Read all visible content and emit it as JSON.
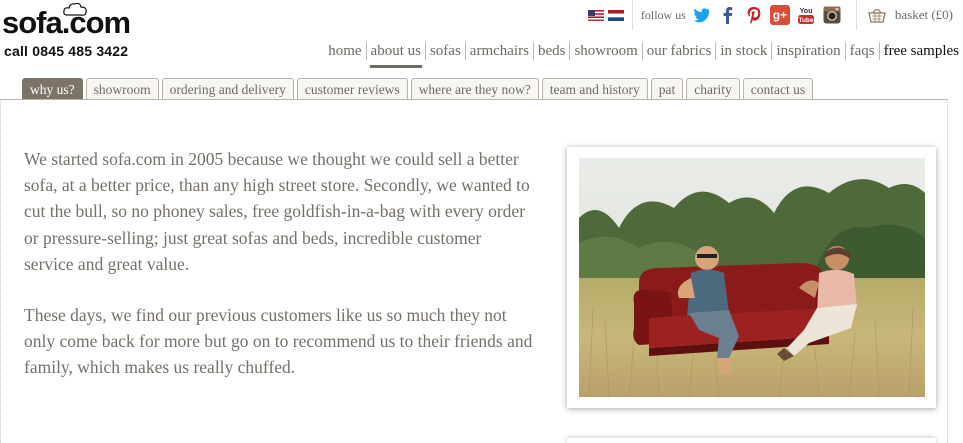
{
  "logo": {
    "text": "sofa.com",
    "phone": "call 0845 485 3422"
  },
  "utility": {
    "flags": [
      "us-flag-icon",
      "netherlands-flag-icon"
    ],
    "follow_label": "follow us",
    "social": [
      "twitter-icon",
      "facebook-icon",
      "pinterest-icon",
      "google-plus-icon",
      "youtube-icon",
      "instagram-icon"
    ],
    "basket_label": "basket (£0)"
  },
  "mainnav": {
    "items": [
      "home",
      "about us",
      "sofas",
      "armchairs",
      "beds",
      "showroom",
      "our fabrics",
      "in stock",
      "inspiration",
      "faqs",
      "free samples"
    ],
    "active": "about us"
  },
  "tabs": {
    "items": [
      "why us?",
      "showroom",
      "ordering and delivery",
      "customer reviews",
      "where are they now?",
      "team and history",
      "pat",
      "charity",
      "contact us"
    ],
    "active": "why us?"
  },
  "content": {
    "paragraphs": [
      "We started sofa.com in 2005 because we thought we could sell a better sofa, at a better price, than any high street store. Secondly, we wanted to cut the bull, so no phoney sales, free goldfish-in-a-bag with every order or pressure-selling; just great sofas and beds, incredible customer service and great value.",
      "These days, we find our previous customers like us so much they not only come back for more but go on to recommend us to their friends and family, which makes us really chuffed."
    ]
  },
  "colors": {
    "text": "#757068",
    "active_tab": "#7b7568",
    "tab_border": "#b9b4a9",
    "sofa": "#8b1a1a",
    "twitter": "#1da1f2",
    "facebook": "#3b5998",
    "pinterest": "#cb2027",
    "google": "#dd4b39",
    "youtube": "#c4302b"
  }
}
